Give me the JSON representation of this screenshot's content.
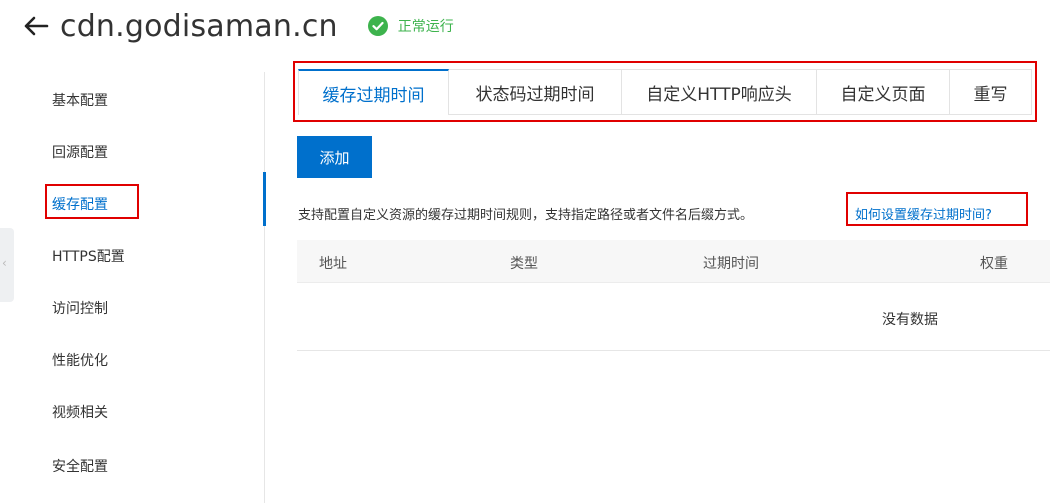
{
  "header": {
    "domain": "cdn.godisaman.cn",
    "status_text": "正常运行"
  },
  "sidebar": {
    "items": [
      {
        "label": "基本配置"
      },
      {
        "label": "回源配置"
      },
      {
        "label": "缓存配置"
      },
      {
        "label": "HTTPS配置"
      },
      {
        "label": "访问控制"
      },
      {
        "label": "性能优化"
      },
      {
        "label": "视频相关"
      },
      {
        "label": "安全配置"
      }
    ]
  },
  "tabs": [
    {
      "label": "缓存过期时间"
    },
    {
      "label": "状态码过期时间"
    },
    {
      "label": "自定义HTTP响应头"
    },
    {
      "label": "自定义页面"
    },
    {
      "label": "重写"
    }
  ],
  "toolbar": {
    "add_label": "添加"
  },
  "description": {
    "text": "支持配置自定义资源的缓存过期时间规则，支持指定路径或者文件名后缀方式。",
    "help_link": "如何设置缓存过期时间?"
  },
  "table": {
    "columns": [
      "地址",
      "类型",
      "过期时间",
      "权重"
    ],
    "empty_text": "没有数据"
  },
  "colors": {
    "accent": "#0070cc",
    "status_green": "#3db34d",
    "highlight_red": "#e00000"
  }
}
